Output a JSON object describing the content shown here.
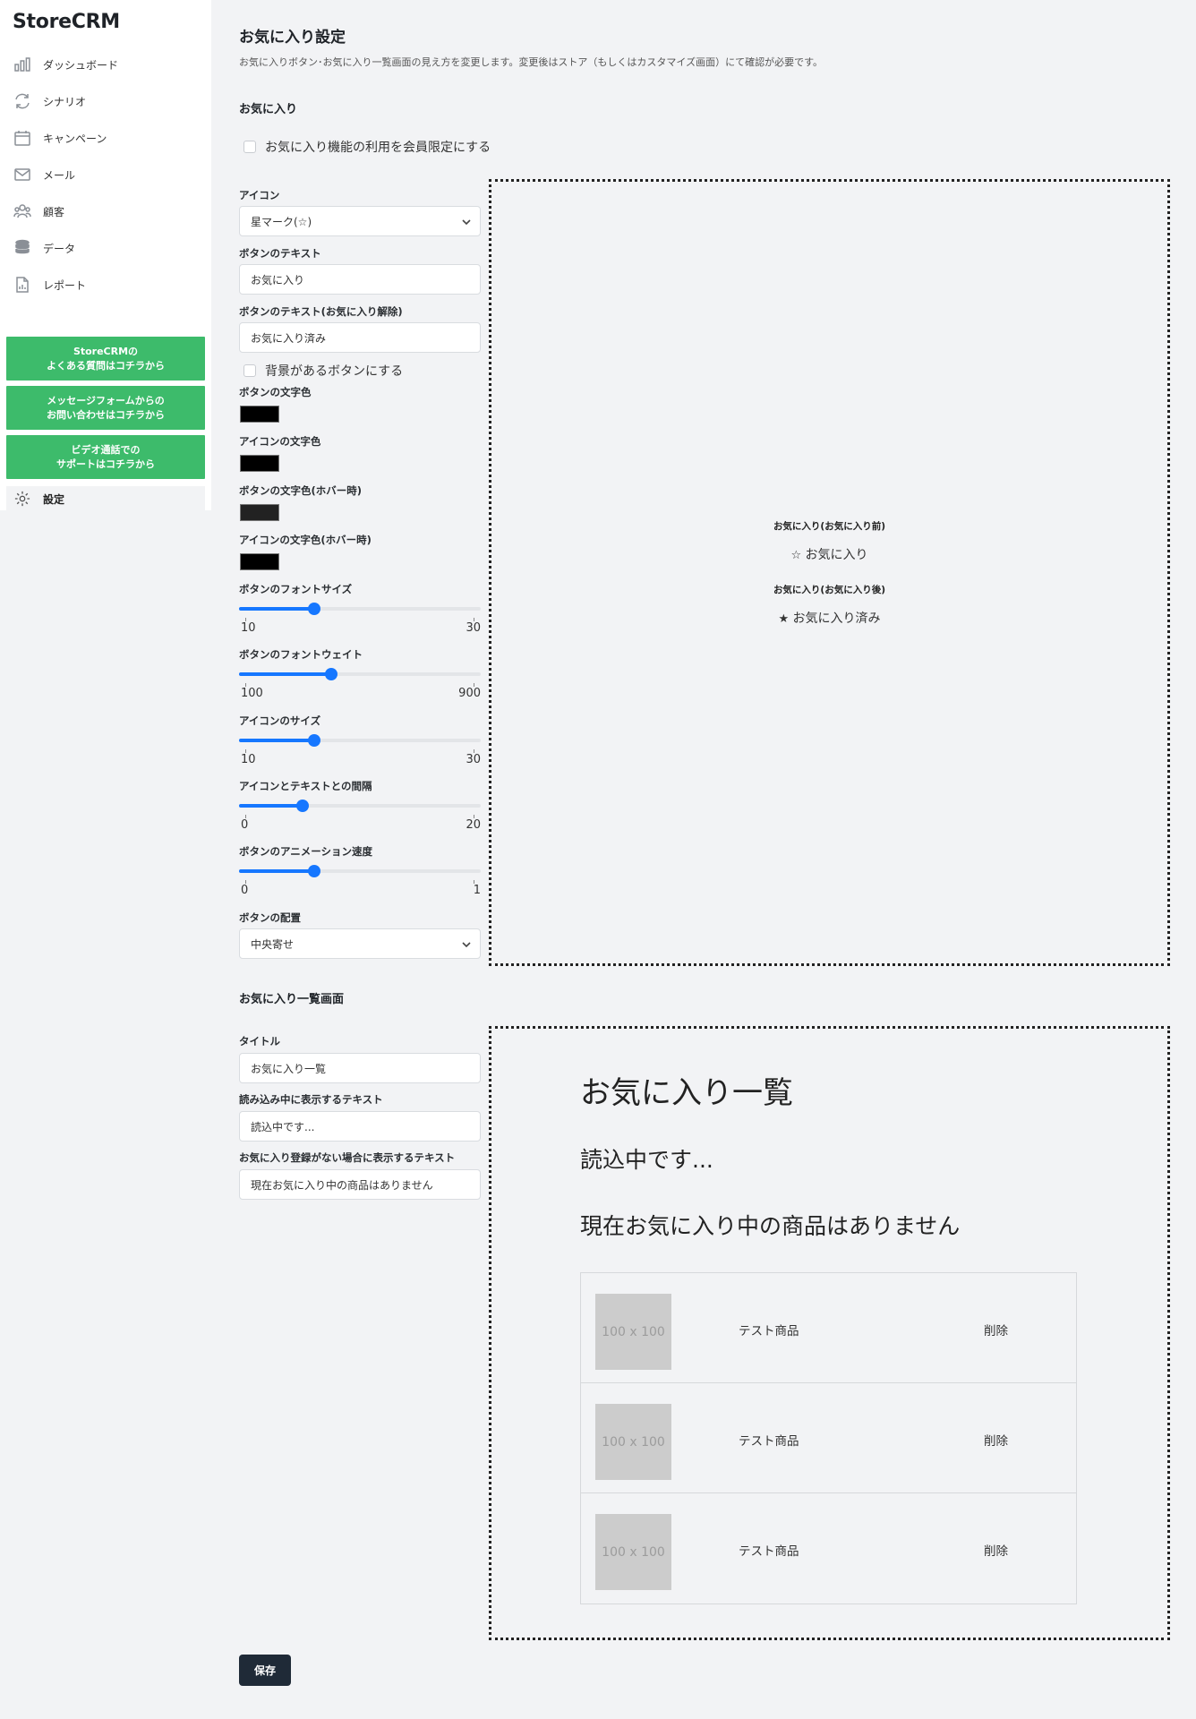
{
  "app": {
    "logo": "StoreCRM"
  },
  "sidebar": {
    "items": [
      {
        "label": "ダッシュボード",
        "icon": "bar-chart-icon"
      },
      {
        "label": "シナリオ",
        "icon": "refresh-icon"
      },
      {
        "label": "キャンペーン",
        "icon": "calendar-icon"
      },
      {
        "label": "メール",
        "icon": "mail-icon"
      },
      {
        "label": "顧客",
        "icon": "users-icon"
      },
      {
        "label": "データ",
        "icon": "database-icon"
      },
      {
        "label": "レポート",
        "icon": "report-icon"
      }
    ],
    "help": [
      {
        "line1": "StoreCRMの",
        "line2": "よくある質問はコチラから"
      },
      {
        "line1": "メッセージフォームからの",
        "line2": "お問い合わせはコチラから"
      },
      {
        "line1": "ビデオ通話での",
        "line2": "サポートはコチラから"
      }
    ],
    "settings_label": "設定",
    "accent_color": "#3dbb6b"
  },
  "page": {
    "title": "お気に入り設定",
    "description": "お気に入りボタン･お気に入り一覧画面の見え方を変更します。変更後はストア（もしくはカスタマイズ画面）にて確認が必要です。"
  },
  "favorite": {
    "section_title": "お気に入り",
    "members_only_label": "お気に入り機能の利用を会員限定にする",
    "members_only_checked": false,
    "icon_label": "アイコン",
    "icon_value": "星マーク(☆)",
    "button_text_label": "ボタンのテキスト",
    "button_text_value": "お気に入り",
    "button_text_remove_label": "ボタンのテキスト(お気に入り解除)",
    "button_text_remove_value": "お気に入り済み",
    "bg_button_label": "背景があるボタンにする",
    "bg_button_checked": false,
    "colors": [
      {
        "label": "ボタンの文字色",
        "value": "#000000"
      },
      {
        "label": "アイコンの文字色",
        "value": "#000000"
      },
      {
        "label": "ボタンの文字色(ホバー時)",
        "value": "#222222"
      },
      {
        "label": "アイコンの文字色(ホバー時)",
        "value": "#000000"
      }
    ],
    "sliders": [
      {
        "label": "ボタンのフォントサイズ",
        "min": "10",
        "max": "30",
        "value": 16
      },
      {
        "label": "ボタンのフォントウェイト",
        "min": "100",
        "max": "900",
        "value": 400
      },
      {
        "label": "アイコンのサイズ",
        "min": "10",
        "max": "30",
        "value": 16
      },
      {
        "label": "アイコンとテキストとの間隔",
        "min": "0",
        "max": "20",
        "value": 5
      },
      {
        "label": "ボタンのアニメーション速度",
        "min": "0",
        "max": "1",
        "value": 0.3
      }
    ],
    "align_label": "ボタンの配置",
    "align_value": "中央寄せ",
    "preview": {
      "before_label": "お気に入り(お気に入り前)",
      "before_icon": "☆",
      "before_text": "お気に入り",
      "after_label": "お気に入り(お気に入り後)",
      "after_icon": "★",
      "after_text": "お気に入り済み"
    }
  },
  "list": {
    "section_title": "お気に入り一覧画面",
    "title_label": "タイトル",
    "title_value": "お気に入り一覧",
    "loading_label": "読み込み中に表示するテキスト",
    "loading_value": "読込中です...",
    "empty_label": "お気に入り登録がない場合に表示するテキスト",
    "empty_value": "現在お気に入り中の商品はありません",
    "preview": {
      "title": "お気に入り一覧",
      "loading": "読込中です...",
      "empty": "現在お気に入り中の商品はありません",
      "items": [
        {
          "image": "100 x 100",
          "name": "テスト商品",
          "delete": "削除"
        },
        {
          "image": "100 x 100",
          "name": "テスト商品",
          "delete": "削除"
        },
        {
          "image": "100 x 100",
          "name": "テスト商品",
          "delete": "削除"
        }
      ]
    }
  },
  "save_label": "保存"
}
